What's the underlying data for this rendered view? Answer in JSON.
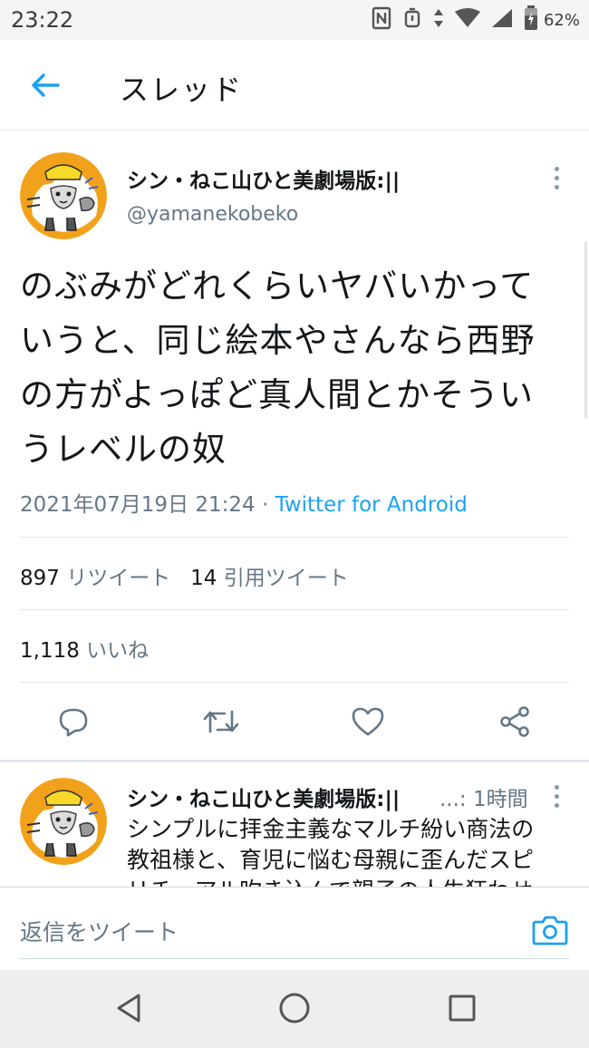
{
  "status_bar": {
    "time": "23:22",
    "battery": "62%",
    "icons": [
      "nfc-icon",
      "alarm-icon",
      "data-arrows-icon",
      "wifi-icon",
      "signal-icon",
      "battery-icon"
    ]
  },
  "header": {
    "title": "スレッド",
    "back_icon": "arrow-left-icon"
  },
  "tweet": {
    "author_name": "シン・ねこ山ひと美劇場版:||",
    "author_handle": "@yamanekobeko",
    "lines": [
      "のぶみがどれくらいヤバいかって",
      "いうと、同じ絵本やさんなら西野",
      "の方がよっぽど真人間とかそうい",
      "うレベルの奴"
    ],
    "timestamp": "2021年07月19日 21:24 · ",
    "source": "Twitter for Android",
    "retweets_count": "897",
    "retweets_label": "リツイート",
    "quotes_count": "14",
    "quotes_label": "引用ツイート",
    "likes_count": "1,118",
    "likes_label": "いいね"
  },
  "actions": [
    "reply-icon",
    "retweet-icon",
    "like-icon",
    "share-icon"
  ],
  "reply_preview": {
    "author_name": "シン・ねこ山ひと美劇場版:||",
    "time": "...: 1時間",
    "lines": [
      "シンプルに拝金主義なマルチ紛い商法の",
      "教祖様と、育児に悩む母親に歪んだスピ",
      "リチュアル吹き込んで親子の人生狂わせ"
    ]
  },
  "compose": {
    "placeholder": "返信をツイート",
    "camera_icon": "camera-icon"
  },
  "nav_bar": [
    "back-triangle-icon",
    "home-circle-icon",
    "recents-square-icon"
  ],
  "colors": {
    "accent": "#1da1f2",
    "secondary_text": "#657786",
    "divider": "#e1e8ed"
  }
}
